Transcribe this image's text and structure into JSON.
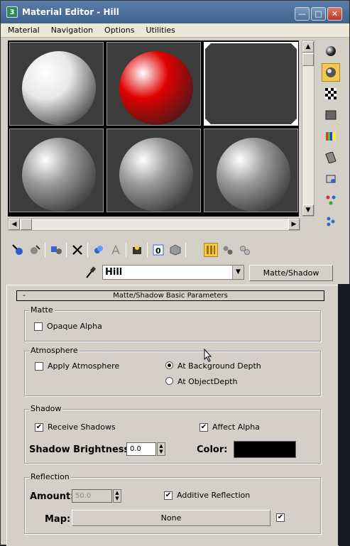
{
  "window": {
    "app_icon": "3",
    "title": "Material Editor - Hill",
    "minimize": "—",
    "maximize": "□",
    "close": "✕"
  },
  "menu": [
    "Material",
    "Navigation",
    "Options",
    "Utilities"
  ],
  "slots": [
    {
      "color": "#e8e8e8",
      "selected": false
    },
    {
      "color": "#e00000",
      "selected": false
    },
    {
      "color": "#3a3a3a",
      "selected": true,
      "empty": true
    },
    {
      "color": "#9a9a9a",
      "selected": false
    },
    {
      "color": "#9a9a9a",
      "selected": false
    },
    {
      "color": "#9a9a9a",
      "selected": false
    }
  ],
  "side_icons": [
    "sample-type-sphere-icon",
    "backlight-icon",
    "background-checker-icon",
    "sample-uv-tiling-icon",
    "video-color-check-icon",
    "make-preview-icon",
    "options-icon",
    "select-by-material-icon",
    "material-map-navigator-icon"
  ],
  "toolbar_icons": [
    "get-material-icon",
    "put-to-scene-icon",
    "assign-to-selection-icon",
    "reset-map-icon",
    "make-copy-icon",
    "make-unique-icon",
    "put-to-library-icon",
    "material-effects-channel-icon",
    "show-map-in-viewport-icon",
    "show-end-result-icon",
    "go-to-parent-icon",
    "go-forward-to-sibling-icon"
  ],
  "material_name": "Hill",
  "material_type": "Matte/Shadow",
  "rollout": {
    "toggle": "-",
    "title": "Matte/Shadow Basic Parameters"
  },
  "matte": {
    "title": "Matte",
    "opaque_alpha_label": "Opaque Alpha",
    "opaque_alpha": false
  },
  "atmosphere": {
    "title": "Atmosphere",
    "apply_label": "Apply Atmosphere",
    "apply": false,
    "bg_depth_label": "At Background Depth",
    "obj_depth_label": "At ObjectDepth",
    "selected": "At Background Depth"
  },
  "shadow": {
    "title": "Shadow",
    "receive_label": "Receive Shadows",
    "receive": true,
    "affect_alpha_label": "Affect Alpha",
    "affect_alpha": true,
    "brightness_label": "Shadow Brightness:",
    "brightness": "0.0",
    "color_label": "Color:",
    "color": "#000000"
  },
  "reflection": {
    "title": "Reflection",
    "amount_label": "Amount:",
    "amount": "50.0",
    "additive_label": "Additive Reflection",
    "additive": true,
    "map_label": "Map:",
    "map_value": "None",
    "map_enabled": true
  },
  "check_mark": "✔"
}
